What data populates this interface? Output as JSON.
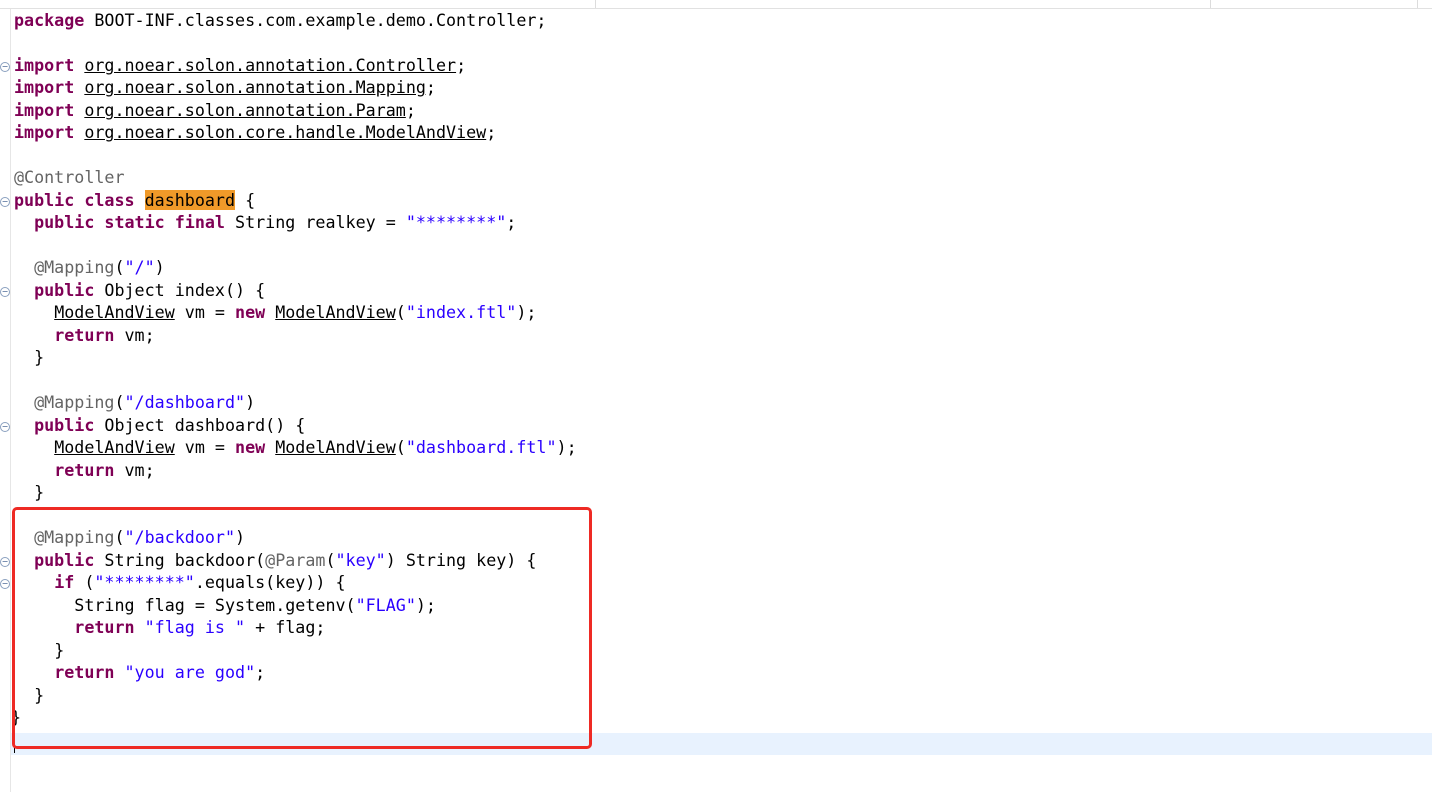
{
  "code": {
    "package": {
      "kw": "package",
      "name": "BOOT-INF.classes.com.example.demo.Controller;"
    },
    "imports": [
      {
        "kw": "import",
        "pkg": "org.noear.solon.annotation.Controller"
      },
      {
        "kw": "import",
        "pkg": "org.noear.solon.annotation.Mapping"
      },
      {
        "kw": "import",
        "pkg": "org.noear.solon.annotation.Param"
      },
      {
        "kw": "import",
        "pkg": "org.noear.solon.core.handle.ModelAndView"
      }
    ],
    "class_annotation": "@Controller",
    "class_decl": {
      "kw": "public class",
      "name": "dashboard",
      "rest": " {"
    },
    "field": {
      "kw": "public static final",
      "rest": " String realkey = ",
      "value": "\"********\"",
      "end": ";"
    },
    "method_index": {
      "annotation": "@Mapping",
      "path": "\"/\"",
      "kw": "public",
      "signature": " Object index() {",
      "type": "ModelAndView",
      "mid": " vm = ",
      "new_kw": "new",
      "view": "\"index.ftl\"",
      "return_kw": "return",
      "return_rest": " vm;",
      "close": "}"
    },
    "method_dashboard": {
      "annotation": "@Mapping",
      "path": "\"/dashboard\"",
      "kw": "public",
      "signature": " Object dashboard() {",
      "type": "ModelAndView",
      "mid": " vm = ",
      "new_kw": "new",
      "view": "\"dashboard.ftl\"",
      "return_kw": "return",
      "return_rest": " vm;",
      "close": "}"
    },
    "method_backdoor": {
      "annotation": "@Mapping",
      "path": "\"/backdoor\"",
      "kw": "public",
      "sig_a": " String backdoor(",
      "param_ann": "@Param",
      "param_key": "\"key\"",
      "sig_b": ") String key) {",
      "if_kw": "if",
      "if_a": " (",
      "if_str": "\"********\"",
      "if_b": ".equals(key)) {",
      "flag_a": "String flag = System.getenv(",
      "flag_str": "\"FLAG\"",
      "flag_b": ");",
      "ret1_kw": "return",
      "ret1_str": "\"flag is \"",
      "ret1_rest": " + flag;",
      "if_close": "}",
      "ret2_kw": "return",
      "ret2_str": "\"you are god\"",
      "ret2_end": ";",
      "close": "}"
    },
    "class_close": "}"
  },
  "colors": {
    "keyword": "#7f0055",
    "string": "#2a00ff",
    "annotation": "#646464",
    "highlight": "#f09a29",
    "red_box": "#ee2a24",
    "current_line": "#e8f2fe"
  }
}
